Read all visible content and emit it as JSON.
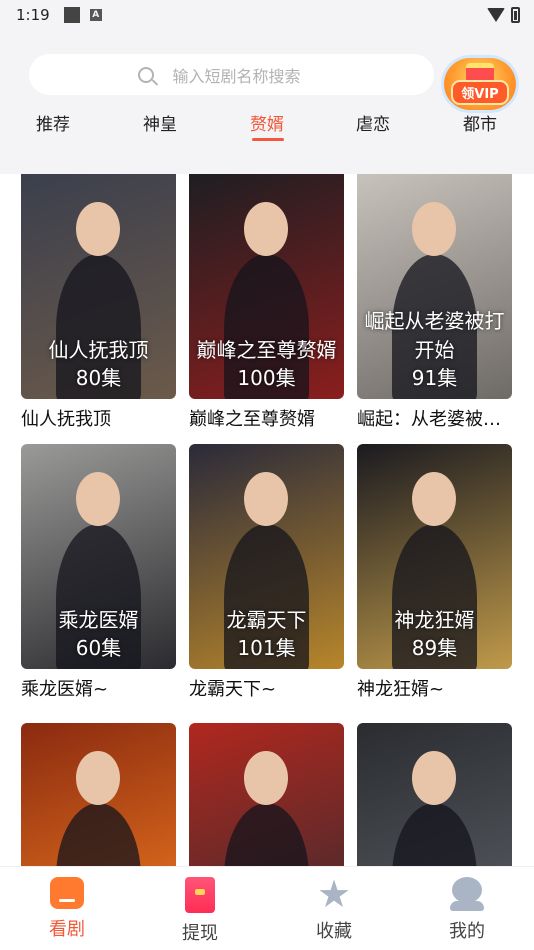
{
  "status_bar": {
    "time": "1:19",
    "a_badge": "A"
  },
  "search": {
    "placeholder": "输入短剧名称搜索",
    "icon": "search-icon"
  },
  "vip": {
    "label": "领VIP"
  },
  "tabs": [
    {
      "label": "推荐",
      "active": false
    },
    {
      "label": "神皇",
      "active": false
    },
    {
      "label": "赘婿",
      "active": true
    },
    {
      "label": "虐恋",
      "active": false
    },
    {
      "label": "都市",
      "active": false
    }
  ],
  "dramas": [
    {
      "title": "仙人抚我顶",
      "episodes": "80集",
      "poster_art": "仙人抚我顶",
      "colors": [
        "#3b3f4d",
        "#6b5a4a"
      ]
    },
    {
      "title": "巅峰之至尊赘婿",
      "episodes": "100集",
      "poster_art": "巅峰之至尊赘婿",
      "colors": [
        "#1e1e22",
        "#8b1e1e"
      ]
    },
    {
      "title": "崛起：从老婆被打开始",
      "episodes": "91集",
      "poster_art": "崛起从老婆被打开始",
      "colors": [
        "#c8c2bc",
        "#6e6a66"
      ]
    },
    {
      "title": "乘龙医婿~",
      "episodes": "60集",
      "poster_art": "乘龙医婿",
      "colors": [
        "#9a9a98",
        "#2b2b2f"
      ]
    },
    {
      "title": "龙霸天下~",
      "episodes": "101集",
      "poster_art": "龙霸天下",
      "colors": [
        "#2a2a3a",
        "#b8862a"
      ]
    },
    {
      "title": "神龙狂婿~",
      "episodes": "89集",
      "poster_art": "神龙狂婿",
      "colors": [
        "#1a1a20",
        "#c09a4a"
      ]
    },
    {
      "title": "",
      "episodes": "",
      "poster_art": "",
      "colors": [
        "#8a2a10",
        "#f07a20"
      ]
    },
    {
      "title": "",
      "episodes": "",
      "poster_art": "",
      "colors": [
        "#b0281e",
        "#3a2a30"
      ]
    },
    {
      "title": "",
      "episodes": "",
      "poster_art": "",
      "colors": [
        "#2a2c30",
        "#5a5e64"
      ]
    }
  ],
  "bottom_nav": [
    {
      "label": "看剧",
      "icon": "home-icon",
      "active": true
    },
    {
      "label": "提现",
      "icon": "wallet-icon",
      "active": false
    },
    {
      "label": "收藏",
      "icon": "star-icon",
      "active": false
    },
    {
      "label": "我的",
      "icon": "user-icon",
      "active": false
    }
  ],
  "accent": "#f05a3a"
}
